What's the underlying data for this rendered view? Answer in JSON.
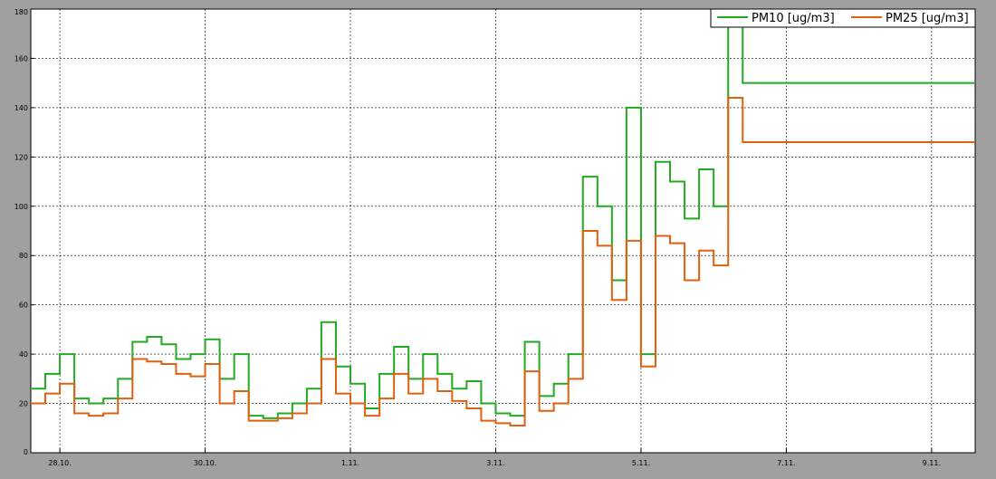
{
  "chart_data": {
    "type": "line",
    "title": "",
    "xlabel": "",
    "ylabel": "",
    "ylim": [
      0,
      180
    ],
    "y_ticks": [
      0,
      20,
      40,
      60,
      80,
      100,
      120,
      140,
      160,
      180
    ],
    "x_range_days": [
      27.6,
      37.4
    ],
    "x_ticks": [
      {
        "label": "28.10.",
        "day": 28
      },
      {
        "label": "30.10.",
        "day": 30
      },
      {
        "label": "1.11.",
        "day": 32
      },
      {
        "label": "3.11.",
        "day": 34
      },
      {
        "label": "5.11.",
        "day": 36
      },
      {
        "label": "7.11.",
        "day": 38
      },
      {
        "label": "9.11.",
        "day": 40
      }
    ],
    "grid": true,
    "legend_position": "top-right",
    "colors": {
      "pm10": "#22aa22",
      "pm25": "#e06010",
      "plot_bg": "#ffffff",
      "frame_bg": "#a0a0a0"
    },
    "series": [
      {
        "name": "PM10 [ug/m3]",
        "color": "#22aa22",
        "values": [
          [
            27.6,
            26
          ],
          [
            27.8,
            32
          ],
          [
            28.0,
            40
          ],
          [
            28.2,
            22
          ],
          [
            28.4,
            20
          ],
          [
            28.6,
            22
          ],
          [
            28.8,
            30
          ],
          [
            29.0,
            45
          ],
          [
            29.2,
            47
          ],
          [
            29.4,
            44
          ],
          [
            29.6,
            38
          ],
          [
            29.8,
            40
          ],
          [
            30.0,
            46
          ],
          [
            30.2,
            30
          ],
          [
            30.4,
            40
          ],
          [
            30.6,
            15
          ],
          [
            30.8,
            14
          ],
          [
            31.0,
            16
          ],
          [
            31.2,
            20
          ],
          [
            31.4,
            26
          ],
          [
            31.6,
            53
          ],
          [
            31.8,
            35
          ],
          [
            32.0,
            28
          ],
          [
            32.2,
            18
          ],
          [
            32.4,
            32
          ],
          [
            32.6,
            43
          ],
          [
            32.8,
            30
          ],
          [
            33.0,
            40
          ],
          [
            33.2,
            32
          ],
          [
            33.4,
            26
          ],
          [
            33.6,
            29
          ],
          [
            33.8,
            20
          ],
          [
            34.0,
            16
          ],
          [
            34.2,
            15
          ],
          [
            34.4,
            45
          ],
          [
            34.6,
            23
          ],
          [
            34.8,
            28
          ],
          [
            35.0,
            40
          ],
          [
            35.2,
            112
          ],
          [
            35.4,
            100
          ],
          [
            35.6,
            70
          ],
          [
            35.8,
            140
          ],
          [
            36.0,
            40
          ],
          [
            36.2,
            118
          ],
          [
            36.4,
            110
          ],
          [
            36.6,
            95
          ],
          [
            36.8,
            115
          ],
          [
            37.0,
            100
          ],
          [
            37.2,
            178
          ],
          [
            37.4,
            150
          ]
        ]
      },
      {
        "name": "PM25 [ug/m3]",
        "color": "#e06010",
        "values": [
          [
            27.6,
            20
          ],
          [
            27.8,
            24
          ],
          [
            28.0,
            28
          ],
          [
            28.2,
            16
          ],
          [
            28.4,
            15
          ],
          [
            28.6,
            16
          ],
          [
            28.8,
            22
          ],
          [
            29.0,
            38
          ],
          [
            29.2,
            37
          ],
          [
            29.4,
            36
          ],
          [
            29.6,
            32
          ],
          [
            29.8,
            31
          ],
          [
            30.0,
            36
          ],
          [
            30.2,
            20
          ],
          [
            30.4,
            25
          ],
          [
            30.6,
            13
          ],
          [
            30.8,
            13
          ],
          [
            31.0,
            14
          ],
          [
            31.2,
            16
          ],
          [
            31.4,
            20
          ],
          [
            31.6,
            38
          ],
          [
            31.8,
            24
          ],
          [
            32.0,
            20
          ],
          [
            32.2,
            15
          ],
          [
            32.4,
            22
          ],
          [
            32.6,
            32
          ],
          [
            32.8,
            24
          ],
          [
            33.0,
            30
          ],
          [
            33.2,
            25
          ],
          [
            33.4,
            21
          ],
          [
            33.6,
            18
          ],
          [
            33.8,
            13
          ],
          [
            34.0,
            12
          ],
          [
            34.2,
            11
          ],
          [
            34.4,
            33
          ],
          [
            34.6,
            17
          ],
          [
            34.8,
            20
          ],
          [
            35.0,
            30
          ],
          [
            35.2,
            90
          ],
          [
            35.4,
            84
          ],
          [
            35.6,
            62
          ],
          [
            35.8,
            86
          ],
          [
            36.0,
            35
          ],
          [
            36.2,
            88
          ],
          [
            36.4,
            85
          ],
          [
            36.6,
            70
          ],
          [
            36.8,
            82
          ],
          [
            37.0,
            76
          ],
          [
            37.2,
            144
          ],
          [
            37.4,
            126
          ]
        ]
      }
    ]
  }
}
